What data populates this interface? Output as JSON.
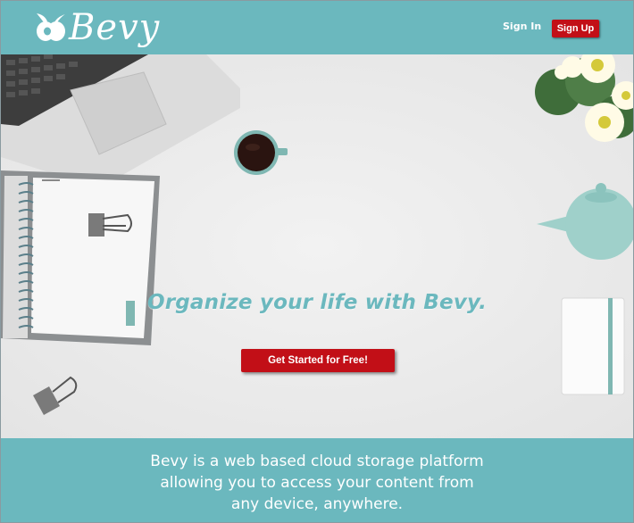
{
  "header": {
    "logo_text": "Bevy",
    "sign_in": "Sign In",
    "sign_up": "Sign Up"
  },
  "hero": {
    "headline": "Organize your life with Bevy.",
    "cta": "Get Started for Free!"
  },
  "band": {
    "line1": "Bevy is a web based cloud storage platform",
    "line2": "allowing you to access your content from",
    "line3": "any device, anywhere."
  },
  "colors": {
    "teal": "#6bb8be",
    "red": "#c20f17",
    "background": "#ececec"
  }
}
